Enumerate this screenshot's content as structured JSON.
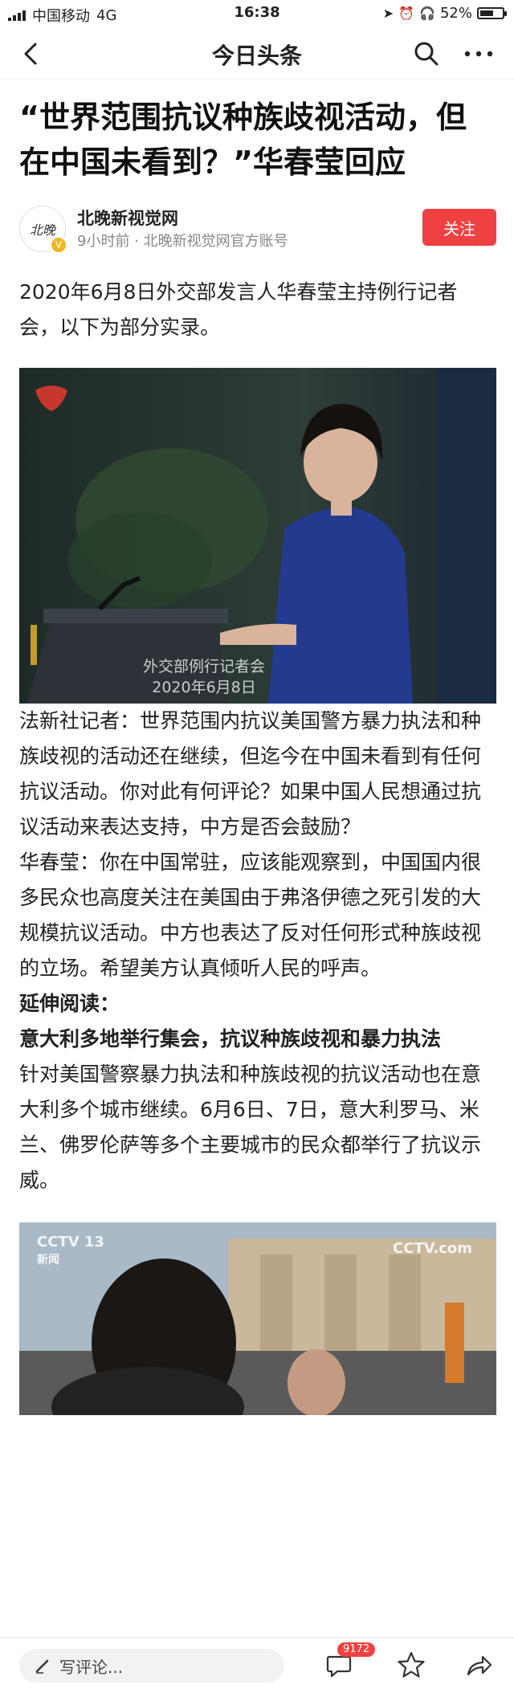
{
  "status_bar": {
    "carrier": "中国移动",
    "network": "4G",
    "time": "16:38",
    "battery": "52%"
  },
  "nav": {
    "title": "今日头条",
    "back_icon": "back-arrow-icon",
    "search_icon": "search-icon",
    "more_icon": "more-dots-icon"
  },
  "article": {
    "title": "“世界范围抗议种族歧视活动，但在中国未看到？”华春莹回应",
    "author": {
      "avatar_text": "北晚",
      "name": "北晚新视觉网",
      "meta": "9小时前 · 北晚新视觉网官方账号",
      "follow_label": "关注"
    },
    "intro": "2020年6月8日外交部发言人华春莹主持例行记者会，以下为部分实录。",
    "photo1_caption_line1": "外交部例行记者会",
    "photo1_caption_line2": "2020年6月8日",
    "question": "法新社记者：世界范围内抗议美国警方暴力执法和种族歧视的活动还在继续，但迄今在中国未看到有任何抗议活动。你对此有何评论？如果中国人民想通过抗议活动来表达支持，中方是否会鼓励？",
    "answer": "华春莹：你在中国常驻，应该能观察到，中国国内很多民众也高度关注在美国由于弗洛伊德之死引发的大规模抗议活动。中方也表达了反对任何形式种族歧视的立场。希望美方认真倾听人民的呼声。",
    "extended_heading": "延伸阅读：",
    "sub_heading": "意大利多地举行集会，抗议种族歧视和暴力执法",
    "sub_body": "针对美国警察暴力执法和种族歧视的抗议活动也在意大利多个城市继续。6月6日、7日，意大利罗马、米兰、佛罗伦萨等多个主要城市的民众都举行了抗议示威。",
    "photo2_logo_left": "CCTV 13",
    "photo2_logo_left_sub": "新闻",
    "photo2_logo_right": "CCTV.com"
  },
  "bottom_bar": {
    "comment_placeholder": "写评论...",
    "comment_count": "9172"
  },
  "colors": {
    "accent": "#f04142",
    "text": "#222222",
    "muted": "#888888"
  }
}
